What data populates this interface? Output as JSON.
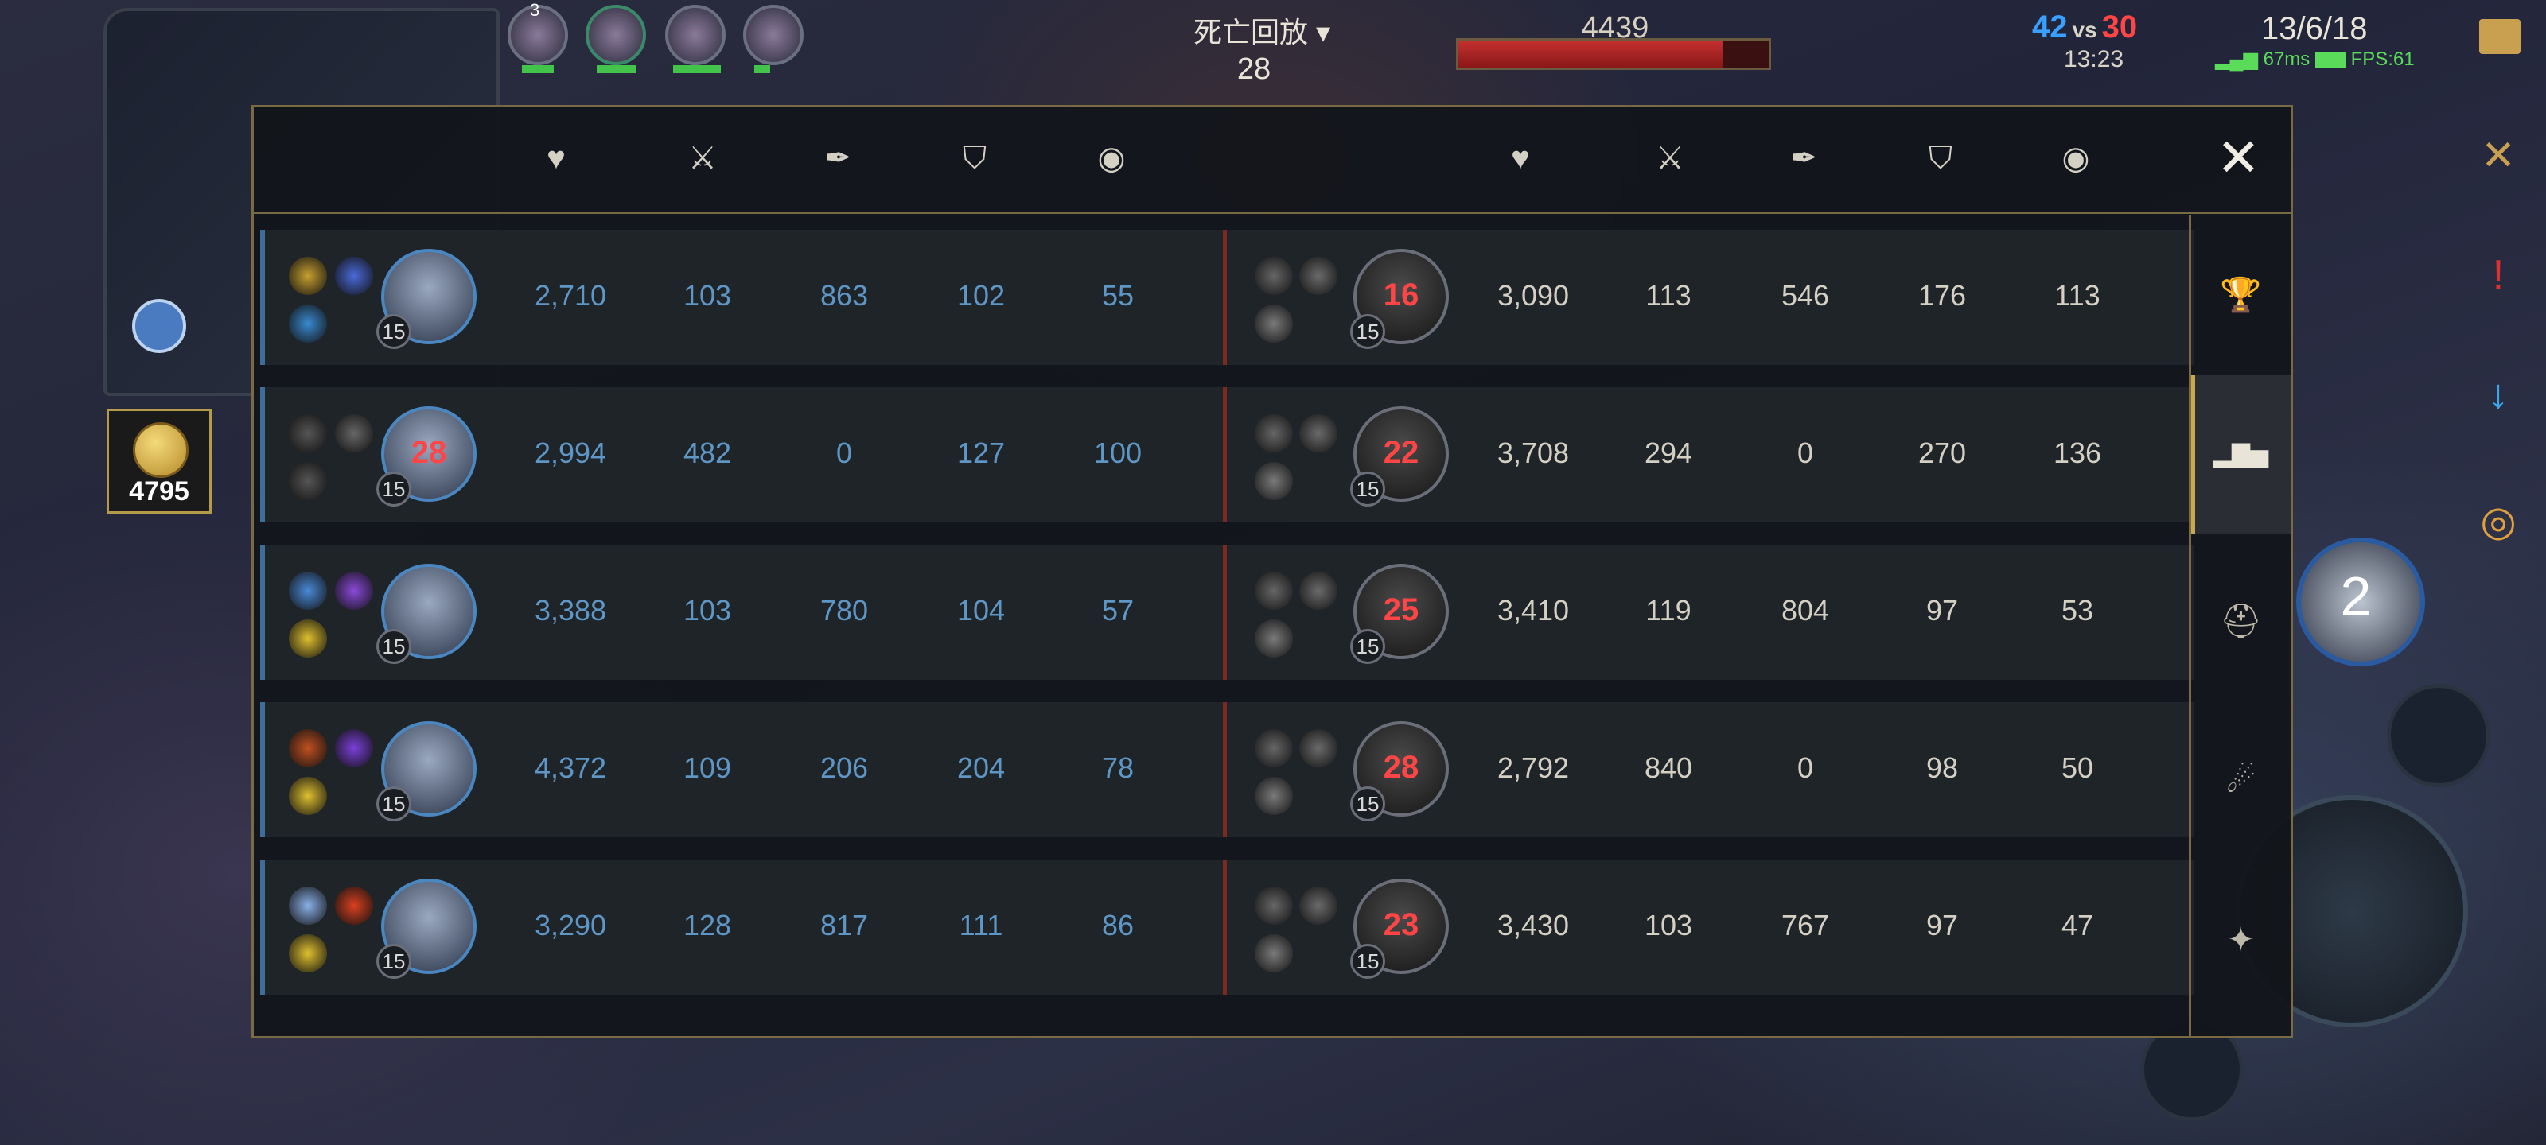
{
  "top_hud": {
    "gold": "4795",
    "death_replay_title": "死亡回放",
    "death_count": "28",
    "boss_hp": "4439",
    "score_blue": "42",
    "score_vs": "vs",
    "score_red": "30",
    "match_time": "13:23",
    "kda": "13/6/18",
    "ping": "67ms",
    "fps": "FPS:61",
    "top_ally_level": "3",
    "ultimate_cooldown": "2"
  },
  "header_icons": [
    "heart-icon",
    "sword-icon",
    "magic-icon",
    "shield-icon",
    "target-icon"
  ],
  "rows": [
    {
      "left": {
        "level": "15",
        "timer": "",
        "stats": [
          "2,710",
          "103",
          "863",
          "102",
          "55"
        ]
      },
      "right": {
        "level": "15",
        "timer": "16",
        "stats": [
          "3,090",
          "113",
          "546",
          "176",
          "113"
        ]
      }
    },
    {
      "left": {
        "level": "15",
        "timer": "28",
        "stats": [
          "2,994",
          "482",
          "0",
          "127",
          "100"
        ]
      },
      "right": {
        "level": "15",
        "timer": "22",
        "stats": [
          "3,708",
          "294",
          "0",
          "270",
          "136"
        ]
      }
    },
    {
      "left": {
        "level": "15",
        "timer": "",
        "stats": [
          "3,388",
          "103",
          "780",
          "104",
          "57"
        ]
      },
      "right": {
        "level": "15",
        "timer": "25",
        "stats": [
          "3,410",
          "119",
          "804",
          "97",
          "53"
        ]
      }
    },
    {
      "left": {
        "level": "15",
        "timer": "",
        "stats": [
          "4,372",
          "109",
          "206",
          "204",
          "78"
        ]
      },
      "right": {
        "level": "15",
        "timer": "28",
        "stats": [
          "2,792",
          "840",
          "0",
          "98",
          "50"
        ]
      }
    },
    {
      "left": {
        "level": "15",
        "timer": "",
        "stats": [
          "3,290",
          "128",
          "817",
          "111",
          "86"
        ]
      },
      "right": {
        "level": "15",
        "timer": "23",
        "stats": [
          "3,430",
          "103",
          "767",
          "97",
          "47"
        ]
      }
    }
  ],
  "tabs": [
    {
      "name": "trophy-tab",
      "icon": "trophy-icon",
      "glyph": "🏆"
    },
    {
      "name": "stats-tab",
      "icon": "bar-chart-icon",
      "glyph": "▂▇▅",
      "active": true
    },
    {
      "name": "helmet-tab",
      "icon": "helmet-icon",
      "glyph": "⛑"
    },
    {
      "name": "swirl-tab",
      "icon": "swirl-icon",
      "glyph": "☄"
    },
    {
      "name": "rune-tab",
      "icon": "rune-icon",
      "glyph": "✦"
    }
  ],
  "colors": {
    "blue_team": "#5e96c6",
    "red_accent": "#ff4545",
    "gold_border": "#7a6a44"
  }
}
